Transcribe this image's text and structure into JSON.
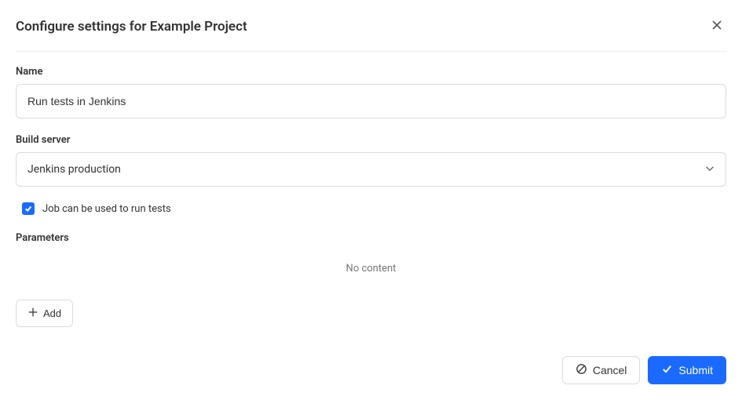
{
  "header": {
    "title": "Configure settings for Example Project"
  },
  "form": {
    "name_label": "Name",
    "name_value": "Run tests in Jenkins",
    "build_server_label": "Build server",
    "build_server_value": "Jenkins production",
    "checkbox_label": "Job can be used to run tests",
    "checkbox_checked": true,
    "parameters_label": "Parameters",
    "no_content_text": "No content",
    "add_button_label": "Add"
  },
  "footer": {
    "cancel_label": "Cancel",
    "submit_label": "Submit"
  }
}
